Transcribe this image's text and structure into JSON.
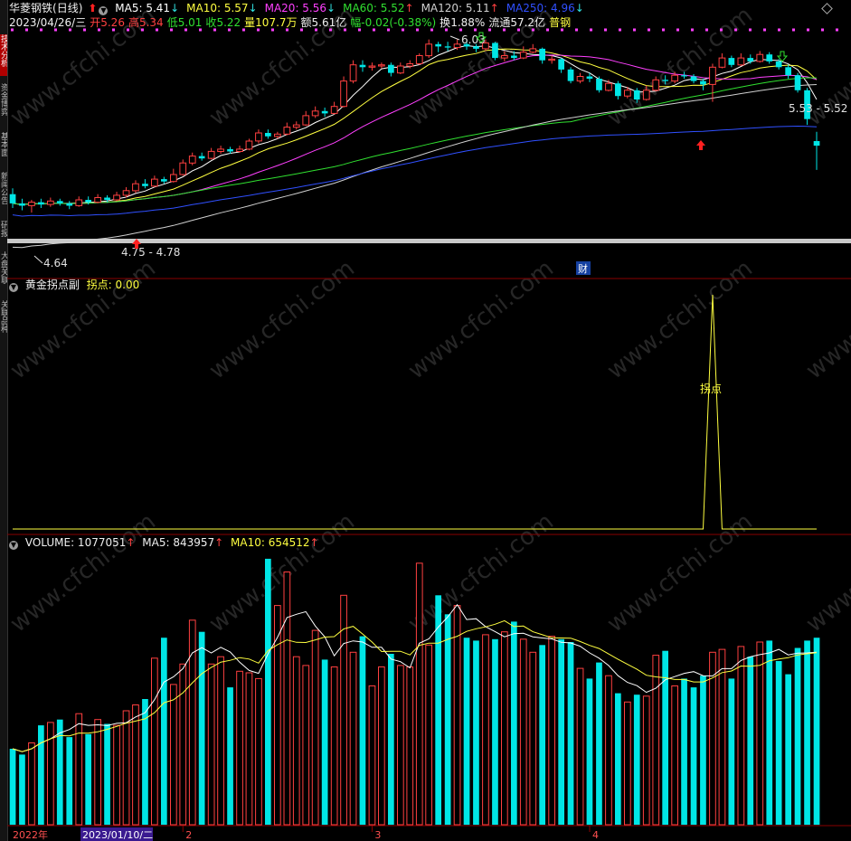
{
  "stock": {
    "name": "华菱钢铁",
    "period": "(日线)",
    "date": "2023/04/26/三",
    "open_label": "开",
    "open": "5.26",
    "high_label": "高",
    "high": "5.34",
    "low_label": "低",
    "low": "5.01",
    "close_label": "收",
    "close": "5.22",
    "vol_label": "量",
    "vol": "107.7万",
    "amount_label": "额",
    "amount": "5.61亿",
    "change_label": "幅",
    "change": "-0.02(-0.38%)",
    "turnover_label": "换",
    "turnover": "1.88%",
    "float_label": "流通",
    "float": "57.2亿",
    "sector": "普钢"
  },
  "ma": [
    {
      "label": "MA5: 5.41",
      "arrow": "↓",
      "color": "#ffffff"
    },
    {
      "label": "MA10: 5.57",
      "arrow": "↓",
      "color": "#ffff40"
    },
    {
      "label": "MA20: 5.56",
      "arrow": "↓",
      "color": "#ff40ff"
    },
    {
      "label": "MA60: 5.52",
      "arrow": "↑",
      "color": "#30e030"
    },
    {
      "label": "MA120: 5.11",
      "arrow": "↑",
      "color": "#d0d0d0"
    },
    {
      "label": "MA250: 4.96",
      "arrow": "↓",
      "color": "#3050ff"
    }
  ],
  "price_annotations": {
    "peak": "6.03",
    "low_point": "4.64",
    "range_left": "4.75 - 4.78",
    "range_right": "5.53 - 5.52",
    "cai": "财"
  },
  "indicator": {
    "title": "黄金拐点副",
    "value_label": "拐点: 0.00",
    "peak_label": "拐点"
  },
  "volume": {
    "title": "VOLUME: 1077051",
    "arrow": "↑",
    "ma5": "MA5: 843957",
    "ma5_arrow": "↑",
    "ma10": "MA10: 654512",
    "ma10_arrow": "↑"
  },
  "xaxis": {
    "year": "2022年",
    "cursor_date": "2023/01/10/二",
    "months": [
      "2",
      "3",
      "4"
    ]
  },
  "watermark": "www.cfchi.com",
  "sidebar_tabs": [
    "技术分析",
    "资金博弈",
    "基本面",
    "新闻公告",
    "研报",
    "大盘关联",
    "关联品种"
  ],
  "colors": {
    "up": "#ff4040",
    "down": "#00e6e6",
    "ma5": "#ffffff",
    "ma10": "#ffff40",
    "ma20": "#ff40ff",
    "ma60": "#30e030",
    "ma120": "#d0d0d0",
    "ma250": "#3050ff"
  },
  "price_range": [
    4.1,
    6.2
  ],
  "candles": [
    [
      4.8,
      4.72,
      4.85,
      4.68
    ],
    [
      4.72,
      4.7,
      4.76,
      4.66
    ],
    [
      4.7,
      4.73,
      4.75,
      4.64
    ],
    [
      4.73,
      4.71,
      4.76,
      4.68
    ],
    [
      4.71,
      4.74,
      4.77,
      4.69
    ],
    [
      4.74,
      4.72,
      4.76,
      4.7
    ],
    [
      4.72,
      4.7,
      4.74,
      4.67
    ],
    [
      4.7,
      4.75,
      4.78,
      4.69
    ],
    [
      4.75,
      4.73,
      4.78,
      4.71
    ],
    [
      4.73,
      4.77,
      4.8,
      4.72
    ],
    [
      4.77,
      4.75,
      4.79,
      4.73
    ],
    [
      4.75,
      4.79,
      4.82,
      4.74
    ],
    [
      4.79,
      4.83,
      4.86,
      4.77
    ],
    [
      4.83,
      4.89,
      4.92,
      4.81
    ],
    [
      4.89,
      4.87,
      4.93,
      4.85
    ],
    [
      4.87,
      4.93,
      4.96,
      4.86
    ],
    [
      4.93,
      4.91,
      4.95,
      4.89
    ],
    [
      4.91,
      4.97,
      5.02,
      4.9
    ],
    [
      4.97,
      5.07,
      5.1,
      4.96
    ],
    [
      5.07,
      5.13,
      5.16,
      5.05
    ],
    [
      5.13,
      5.11,
      5.16,
      5.09
    ],
    [
      5.11,
      5.17,
      5.2,
      5.1
    ],
    [
      5.17,
      5.19,
      5.22,
      5.15
    ],
    [
      5.19,
      5.17,
      5.21,
      5.15
    ],
    [
      5.17,
      5.19,
      5.22,
      5.16
    ],
    [
      5.19,
      5.26,
      5.28,
      5.18
    ],
    [
      5.26,
      5.33,
      5.36,
      5.24
    ],
    [
      5.33,
      5.3,
      5.36,
      5.28
    ],
    [
      5.3,
      5.32,
      5.34,
      5.28
    ],
    [
      5.32,
      5.38,
      5.42,
      5.31
    ],
    [
      5.38,
      5.4,
      5.43,
      5.36
    ],
    [
      5.4,
      5.48,
      5.52,
      5.39
    ],
    [
      5.48,
      5.52,
      5.56,
      5.46
    ],
    [
      5.52,
      5.5,
      5.55,
      5.47
    ],
    [
      5.5,
      5.56,
      5.6,
      5.49
    ],
    [
      5.56,
      5.78,
      5.82,
      5.55
    ],
    [
      5.78,
      5.92,
      5.96,
      5.76
    ],
    [
      5.92,
      5.9,
      5.96,
      5.86
    ],
    [
      5.9,
      5.91,
      5.94,
      5.87
    ],
    [
      5.91,
      5.92,
      5.94,
      5.89
    ],
    [
      5.92,
      5.85,
      5.94,
      5.82
    ],
    [
      5.85,
      5.91,
      5.94,
      5.84
    ],
    [
      5.91,
      5.93,
      5.96,
      5.89
    ],
    [
      5.93,
      6.0,
      6.02,
      5.92
    ],
    [
      6.0,
      6.1,
      6.14,
      5.98
    ],
    [
      6.1,
      6.08,
      6.12,
      6.03
    ],
    [
      6.08,
      6.07,
      6.12,
      6.04
    ],
    [
      6.07,
      6.1,
      6.14,
      6.05
    ],
    [
      6.1,
      6.08,
      6.14,
      6.05
    ],
    [
      6.08,
      6.06,
      6.1,
      6.03
    ],
    [
      6.06,
      6.11,
      6.14,
      6.04
    ],
    [
      6.11,
      5.98,
      6.12,
      5.96
    ],
    [
      5.98,
      6.0,
      6.04,
      5.95
    ],
    [
      6.0,
      5.98,
      6.04,
      5.96
    ],
    [
      5.98,
      6.03,
      6.08,
      5.97
    ],
    [
      6.03,
      6.06,
      6.1,
      6.02
    ],
    [
      6.06,
      5.96,
      6.07,
      5.93
    ],
    [
      5.96,
      5.97,
      6.0,
      5.93
    ],
    [
      5.97,
      5.88,
      5.98,
      5.85
    ],
    [
      5.88,
      5.78,
      5.9,
      5.76
    ],
    [
      5.78,
      5.82,
      5.85,
      5.76
    ],
    [
      5.82,
      5.8,
      5.85,
      5.77
    ],
    [
      5.8,
      5.7,
      5.82,
      5.68
    ],
    [
      5.7,
      5.76,
      5.79,
      5.69
    ],
    [
      5.76,
      5.65,
      5.78,
      5.62
    ],
    [
      5.65,
      5.7,
      5.73,
      5.63
    ],
    [
      5.7,
      5.62,
      5.72,
      5.59
    ],
    [
      5.62,
      5.7,
      5.74,
      5.61
    ],
    [
      5.7,
      5.79,
      5.82,
      5.69
    ],
    [
      5.79,
      5.78,
      5.83,
      5.75
    ],
    [
      5.78,
      5.83,
      5.86,
      5.76
    ],
    [
      5.83,
      5.82,
      5.86,
      5.8
    ],
    [
      5.82,
      5.78,
      5.84,
      5.76
    ],
    [
      5.78,
      5.75,
      5.8,
      5.7
    ],
    [
      5.75,
      5.9,
      5.93,
      5.6
    ],
    [
      5.9,
      5.98,
      6.02,
      5.89
    ],
    [
      5.98,
      5.92,
      6.0,
      5.9
    ],
    [
      5.92,
      5.98,
      6.02,
      5.91
    ],
    [
      5.98,
      5.95,
      6.01,
      5.93
    ],
    [
      5.95,
      6.01,
      6.04,
      5.94
    ],
    [
      6.01,
      5.95,
      6.03,
      5.93
    ],
    [
      5.95,
      5.9,
      5.97,
      5.88
    ],
    [
      5.9,
      5.83,
      5.92,
      5.8
    ],
    [
      5.83,
      5.7,
      5.85,
      5.68
    ],
    [
      5.7,
      5.45,
      5.72,
      5.4
    ],
    [
      5.26,
      5.22,
      5.34,
      5.01
    ]
  ],
  "golden_turn": {
    "max": 1,
    "peak_index": 74,
    "peak_value": 1
  },
  "volumes": [
    520,
    480,
    560,
    680,
    700,
    720,
    600,
    760,
    620,
    720,
    690,
    680,
    780,
    820,
    860,
    1140,
    1280,
    960,
    1100,
    1400,
    1320,
    1100,
    1150,
    940,
    1050,
    1040,
    1000,
    1820,
    1500,
    1730,
    1150,
    1090,
    1330,
    1130,
    1080,
    1570,
    1180,
    1290,
    950,
    1080,
    1170,
    1090,
    1080,
    1790,
    1230,
    1570,
    1440,
    1500,
    1280,
    1260,
    1300,
    1270,
    1320,
    1390,
    1270,
    1180,
    1230,
    1290,
    1270,
    1250,
    1070,
    1000,
    1110,
    1020,
    900,
    840,
    890,
    880,
    1160,
    1190,
    950,
    1000,
    940,
    1020,
    1180,
    1200,
    1000,
    1220,
    1150,
    1250,
    1260,
    1120,
    1030,
    1210,
    1260,
    1280
  ],
  "volume_max": 1900,
  "x_ticks": [
    {
      "label": "2",
      "index": 18
    },
    {
      "label": "3",
      "index": 38
    },
    {
      "label": "4",
      "index": 61
    }
  ]
}
